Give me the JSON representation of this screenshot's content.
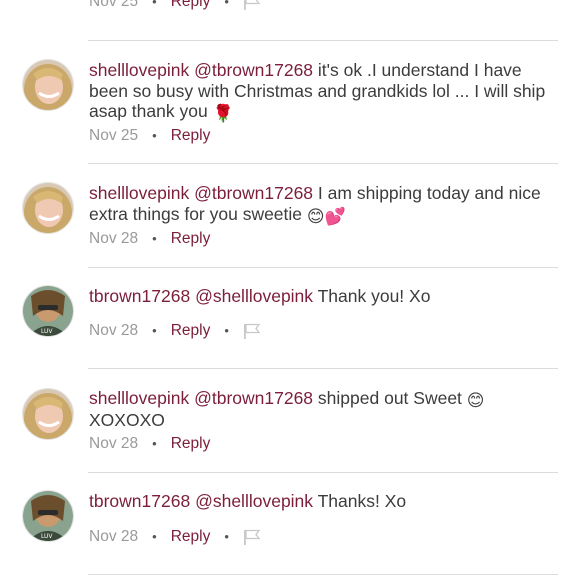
{
  "top_meta": {
    "date": "Nov 25",
    "reply": "Reply"
  },
  "comments": [
    {
      "user": "shelllovepink",
      "mention": "@tbrown17268",
      "text": "it's ok .I understand I have been so busy with Christmas and grandkids lol ... I will ship asap thank you",
      "emoji": "🌹",
      "date": "Nov 25",
      "reply": "Reply"
    },
    {
      "user": "shelllovepink",
      "mention": "@tbrown17268",
      "text": "I am shipping today and nice extra things for you sweetie",
      "emoji": "😊💕",
      "date": "Nov 28",
      "reply": "Reply"
    },
    {
      "user": "tbrown17268",
      "mention": "@shelllovepink",
      "text": "Thank you! Xo",
      "emoji": "",
      "date": "Nov 28",
      "reply": "Reply"
    },
    {
      "user": "shelllovepink",
      "mention": "@tbrown17268",
      "text": "shipped out Sweet",
      "emoji": "😊",
      "text2": "XOXOXO",
      "date": "Nov 28",
      "reply": "Reply"
    },
    {
      "user": "tbrown17268",
      "mention": "@shelllovepink",
      "text": "Thanks! Xo",
      "emoji": "",
      "date": "Nov 28",
      "reply": "Reply"
    }
  ],
  "colors": {
    "username": "#7b1e3a",
    "body": "#3c3c3c",
    "meta": "#9a9a9a",
    "divider": "#dcdcdc"
  },
  "icons": {
    "flag": "flag-icon",
    "avatar_a": "avatar-blonde-woman",
    "avatar_b": "avatar-woman-sunglasses"
  }
}
